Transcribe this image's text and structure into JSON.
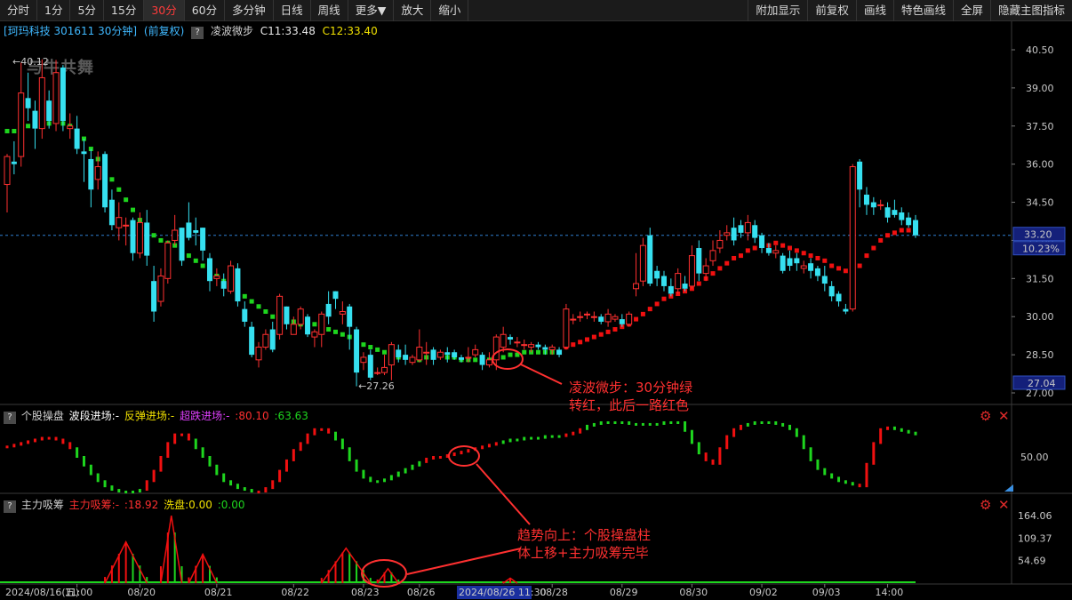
{
  "toolbar": {
    "left": [
      "分时",
      "1分",
      "5分",
      "15分",
      "30分",
      "60分",
      "多分钟",
      "日线",
      "周线",
      "更多▼",
      "放大",
      "缩小"
    ],
    "active_index": 4,
    "right": [
      "附加显示",
      "前复权",
      "画线",
      "特色画线",
      "全屏",
      "隐藏主图指标"
    ]
  },
  "info": {
    "stock": "[珂玛科技 301611 30分钟]",
    "adj": "(前复权)",
    "indicator": "凌波微步",
    "c11": "C11:33.48",
    "c12": "C12:33.40"
  },
  "watermark": "与牛共舞",
  "panel2": {
    "name": "个股操盘",
    "l1": "波段进场:-",
    "l2": "反弹进场:-",
    "l3": "超跌进场:-",
    "v1": ":80.10",
    "v2": ":63.63"
  },
  "panel3": {
    "name": "主力吸筹",
    "l1": "主力吸筹:-",
    "v1": ":18.92",
    "l2": "洗盘:0.00",
    "v2": ":0.00"
  },
  "colors": {
    "up": "#ff3030",
    "down": "#36e0f0",
    "green": "#1ed51e",
    "red": "#f01010",
    "annotation": "#ff3030",
    "price_tag_bg": "#14207a"
  },
  "price_axis": [
    "40.50",
    "39.00",
    "37.50",
    "36.00",
    "34.50",
    "33.00",
    "31.50",
    "30.00",
    "28.50",
    "27.00"
  ],
  "price_tags": {
    "current": "33.20",
    "change": "10.23%",
    "low_axis": "27.04"
  },
  "extremes": {
    "high": "40.12",
    "low": "27.26"
  },
  "panel2_axis": [
    "50.00"
  ],
  "panel3_axis": [
    "164.06",
    "109.37",
    "54.69"
  ],
  "time_axis": {
    "start": "2024/08/16(五)",
    "labels": [
      "11:00",
      "08/20",
      "08/21",
      "08/22",
      "08/23",
      "08/26",
      "08/28",
      "08/29",
      "08/30",
      "09/02",
      "09/03",
      "14:00"
    ],
    "cursor": "2024/08/26 11:30"
  },
  "annotations": [
    {
      "lines": [
        "凌波微步：30分钟绿",
        "转红，此后一路红色"
      ]
    },
    {
      "lines": [
        "趋势向上：个股操盘柱",
        "体上移+主力吸筹完毕"
      ]
    }
  ],
  "chart_data": {
    "type": "candlestick",
    "ylim": [
      27.0,
      40.5
    ],
    "candles": [
      [
        35.2,
        36.3,
        34.1,
        36.4
      ],
      [
        36.1,
        36.0,
        35.6,
        36.9
      ],
      [
        36.3,
        38.8,
        35.9,
        40.0
      ],
      [
        38.6,
        38.2,
        37.7,
        39.6
      ],
      [
        38.1,
        37.4,
        36.6,
        38.5
      ],
      [
        37.4,
        39.4,
        37.0,
        40.12
      ],
      [
        38.5,
        37.7,
        37.4,
        38.9
      ],
      [
        37.6,
        39.6,
        37.3,
        40.1
      ],
      [
        39.8,
        37.7,
        37.3,
        39.9
      ],
      [
        37.4,
        37.5,
        37.0,
        38.0
      ],
      [
        37.4,
        36.6,
        36.4,
        37.9
      ],
      [
        36.5,
        36.4,
        35.3,
        37.0
      ],
      [
        36.2,
        35.0,
        34.3,
        36.6
      ],
      [
        35.4,
        35.9,
        35.0,
        36.5
      ],
      [
        36.4,
        34.3,
        34.1,
        36.5
      ],
      [
        34.6,
        33.6,
        33.4,
        35.0
      ],
      [
        33.5,
        33.9,
        33.0,
        34.5
      ],
      [
        33.6,
        33.6,
        32.8,
        33.9
      ],
      [
        33.8,
        32.5,
        32.2,
        33.9
      ],
      [
        32.5,
        33.7,
        32.3,
        34.1
      ],
      [
        33.7,
        32.4,
        32.0,
        34.2
      ],
      [
        31.4,
        30.2,
        29.8,
        32.0
      ],
      [
        30.6,
        31.6,
        30.4,
        31.9
      ],
      [
        31.5,
        32.9,
        31.3,
        33.0
      ],
      [
        33.0,
        33.4,
        32.8,
        34.0
      ],
      [
        33.5,
        32.2,
        32.0,
        33.5
      ],
      [
        33.7,
        33.1,
        33.0,
        34.5
      ],
      [
        33.4,
        33.3,
        32.8,
        33.9
      ],
      [
        33.5,
        32.6,
        32.2,
        33.5
      ],
      [
        32.3,
        31.4,
        31.0,
        32.5
      ],
      [
        31.5,
        31.6,
        31.2,
        31.9
      ],
      [
        31.4,
        31.1,
        30.8,
        31.7
      ],
      [
        31.0,
        32.0,
        30.9,
        32.2
      ],
      [
        31.9,
        30.6,
        30.4,
        32.1
      ],
      [
        30.3,
        29.8,
        29.6,
        30.6
      ],
      [
        29.6,
        28.5,
        28.4,
        29.8
      ],
      [
        28.3,
        28.8,
        28.0,
        29.0
      ],
      [
        28.8,
        29.3,
        28.7,
        29.5
      ],
      [
        29.5,
        28.7,
        28.6,
        29.8
      ],
      [
        29.3,
        30.8,
        29.1,
        30.9
      ],
      [
        30.4,
        29.7,
        29.5,
        30.4
      ],
      [
        29.3,
        29.7,
        29.3,
        30.0
      ],
      [
        29.7,
        30.3,
        29.5,
        30.4
      ],
      [
        30.0,
        29.3,
        29.2,
        30.1
      ],
      [
        29.2,
        29.4,
        28.8,
        29.5
      ],
      [
        29.3,
        30.1,
        28.8,
        30.2
      ],
      [
        30.5,
        30.0,
        29.7,
        31.0
      ],
      [
        31.0,
        30.7,
        30.3,
        31.0
      ],
      [
        30.1,
        30.2,
        29.7,
        30.6
      ],
      [
        30.4,
        29.6,
        28.7,
        30.5
      ],
      [
        29.5,
        27.8,
        27.26,
        29.6
      ],
      [
        28.2,
        28.4,
        27.9,
        28.6
      ],
      [
        28.5,
        27.6,
        27.5,
        28.7
      ],
      [
        27.8,
        27.8,
        27.7,
        28.0
      ],
      [
        27.8,
        28.0,
        27.7,
        28.5
      ],
      [
        28.1,
        28.9,
        27.5,
        29.0
      ],
      [
        28.7,
        28.4,
        28.2,
        28.9
      ],
      [
        28.5,
        28.3,
        28.1,
        28.9
      ],
      [
        28.2,
        28.4,
        28.1,
        28.5
      ],
      [
        28.3,
        28.8,
        28.2,
        29.5
      ],
      [
        28.6,
        28.6,
        28.1,
        29.0
      ],
      [
        28.7,
        28.3,
        28.1,
        28.8
      ],
      [
        28.4,
        28.6,
        28.3,
        28.7
      ],
      [
        28.6,
        28.5,
        28.2,
        28.8
      ],
      [
        28.6,
        28.4,
        28.3,
        28.7
      ],
      [
        28.4,
        28.3,
        28.2,
        28.5
      ],
      [
        28.4,
        28.4,
        28.2,
        28.8
      ],
      [
        28.5,
        28.7,
        28.4,
        28.9
      ],
      [
        28.5,
        28.1,
        27.9,
        28.6
      ],
      [
        28.1,
        28.3,
        28.0,
        28.6
      ],
      [
        28.3,
        29.2,
        27.9,
        29.3
      ],
      [
        28.8,
        29.3,
        28.6,
        29.6
      ],
      [
        29.2,
        29.1,
        28.9,
        29.3
      ],
      [
        29.0,
        29.0,
        28.8,
        29.2
      ],
      [
        28.9,
        28.9,
        28.7,
        29.1
      ],
      [
        28.8,
        28.9,
        28.6,
        29.0
      ],
      [
        28.9,
        28.8,
        28.7,
        29.0
      ],
      [
        28.8,
        28.7,
        28.5,
        28.9
      ],
      [
        28.7,
        28.8,
        28.5,
        28.9
      ],
      [
        28.7,
        28.5,
        28.4,
        28.8
      ],
      [
        28.8,
        30.3,
        28.7,
        30.5
      ],
      [
        29.9,
        29.9,
        29.7,
        30.1
      ],
      [
        30.0,
        30.0,
        29.8,
        30.2
      ],
      [
        30.1,
        30.1,
        29.9,
        30.2
      ],
      [
        30.0,
        30.0,
        29.8,
        30.2
      ],
      [
        30.0,
        29.8,
        29.7,
        30.1
      ],
      [
        29.8,
        30.1,
        29.6,
        30.3
      ],
      [
        29.9,
        30.0,
        29.8,
        30.1
      ],
      [
        29.9,
        29.7,
        29.6,
        30.1
      ],
      [
        29.7,
        30.1,
        29.6,
        30.2
      ],
      [
        31.1,
        31.3,
        30.8,
        32.5
      ],
      [
        31.4,
        32.8,
        31.2,
        33.1
      ],
      [
        33.2,
        31.3,
        31.2,
        33.5
      ],
      [
        31.8,
        31.5,
        31.2,
        32.0
      ],
      [
        31.6,
        31.2,
        31.0,
        31.8
      ],
      [
        31.2,
        30.9,
        30.8,
        31.5
      ],
      [
        31.1,
        31.7,
        30.9,
        31.9
      ],
      [
        31.3,
        31.1,
        31.0,
        31.6
      ],
      [
        31.2,
        32.4,
        31.1,
        32.8
      ],
      [
        32.7,
        31.7,
        31.4,
        33.0
      ],
      [
        31.7,
        32.0,
        31.4,
        32.3
      ],
      [
        32.2,
        32.6,
        32.0,
        33.0
      ],
      [
        32.7,
        33.0,
        32.5,
        33.4
      ],
      [
        33.2,
        33.3,
        33.0,
        33.6
      ],
      [
        33.5,
        33.0,
        32.8,
        33.9
      ],
      [
        33.6,
        33.3,
        33.1,
        33.8
      ],
      [
        33.3,
        33.7,
        33.0,
        34.0
      ],
      [
        33.6,
        33.1,
        32.9,
        33.8
      ],
      [
        33.2,
        32.7,
        32.5,
        33.3
      ],
      [
        32.7,
        32.5,
        32.4,
        32.9
      ],
      [
        32.5,
        32.6,
        32.3,
        32.8
      ],
      [
        32.4,
        31.8,
        31.7,
        32.5
      ],
      [
        32.3,
        32.0,
        31.8,
        32.6
      ],
      [
        32.3,
        32.1,
        31.8,
        32.5
      ],
      [
        31.9,
        32.0,
        31.7,
        32.2
      ],
      [
        32.1,
        31.8,
        31.5,
        32.3
      ],
      [
        31.9,
        31.6,
        31.4,
        32.0
      ],
      [
        31.6,
        31.3,
        31.0,
        32.0
      ],
      [
        31.2,
        30.8,
        30.6,
        31.4
      ],
      [
        30.9,
        30.6,
        30.4,
        31.0
      ],
      [
        30.3,
        30.2,
        30.1,
        30.5
      ],
      [
        30.3,
        35.9,
        30.2,
        36.0
      ],
      [
        36.1,
        35.0,
        34.3,
        36.2
      ],
      [
        34.8,
        34.4,
        34.0,
        35.1
      ],
      [
        34.5,
        34.3,
        34.0,
        34.7
      ],
      [
        34.4,
        34.4,
        34.2,
        34.6
      ],
      [
        34.3,
        33.9,
        33.7,
        34.5
      ],
      [
        34.2,
        34.0,
        33.9,
        34.6
      ],
      [
        34.1,
        33.8,
        33.6,
        34.3
      ],
      [
        33.9,
        33.6,
        33.5,
        34.1
      ],
      [
        33.8,
        33.2,
        33.1,
        34.0
      ]
    ],
    "lingbo": [
      37.3,
      37.3,
      37.4,
      37.5,
      37.5,
      37.6,
      37.6,
      37.7,
      37.6,
      37.5,
      37.3,
      37.0,
      36.6,
      36.2,
      35.8,
      35.4,
      35.0,
      34.6,
      34.2,
      33.8,
      33.5,
      33.2,
      33.0,
      32.9,
      32.8,
      32.6,
      32.4,
      32.2,
      32.0,
      31.8,
      31.6,
      31.4,
      31.2,
      31.0,
      30.8,
      30.6,
      30.4,
      30.2,
      30.0,
      29.9,
      29.8,
      29.8,
      29.7,
      29.7,
      29.7,
      29.6,
      29.5,
      29.4,
      29.3,
      29.2,
      29.1,
      28.9,
      28.8,
      28.7,
      28.6,
      28.5,
      28.4,
      28.4,
      28.3,
      28.3,
      28.4,
      28.5,
      28.5,
      28.4,
      28.4,
      28.3,
      28.3,
      28.3,
      28.3,
      28.3,
      28.4,
      28.4,
      28.5,
      28.5,
      28.6,
      28.6,
      28.6,
      28.6,
      28.6,
      28.6,
      28.8,
      28.9,
      29.0,
      29.1,
      29.2,
      29.3,
      29.4,
      29.5,
      29.6,
      29.7,
      29.9,
      30.1,
      30.3,
      30.5,
      30.7,
      30.8,
      30.9,
      31.0,
      31.1,
      31.3,
      31.5,
      31.7,
      31.9,
      32.1,
      32.3,
      32.4,
      32.6,
      32.7,
      32.8,
      32.8,
      32.9,
      32.8,
      32.7,
      32.6,
      32.5,
      32.4,
      32.3,
      32.2,
      32.0,
      31.9,
      31.8,
      31.6,
      32.0,
      32.4,
      32.7,
      33.0,
      33.2,
      33.3,
      33.4,
      33.4
    ],
    "lingbo_turn_red_index": 80,
    "caopan": [
      56,
      57,
      58,
      59,
      60,
      61,
      61,
      60,
      58,
      55,
      50,
      45,
      40,
      36,
      33,
      31,
      30,
      30,
      30,
      31,
      36,
      42,
      50,
      58,
      63,
      63,
      60,
      55,
      50,
      45,
      40,
      36,
      34,
      32,
      31,
      30,
      30,
      32,
      36,
      42,
      48,
      54,
      58,
      63,
      66,
      66,
      64,
      60,
      55,
      48,
      42,
      38,
      36,
      36,
      37,
      39,
      41,
      43,
      45,
      47,
      49,
      50,
      50,
      51,
      52,
      53,
      54,
      55,
      56,
      57,
      58,
      59,
      60,
      60,
      61,
      61,
      61,
      62,
      62,
      62,
      63,
      64,
      66,
      68,
      69,
      70,
      70,
      70,
      70,
      69,
      69,
      69,
      69,
      69,
      70,
      70,
      70,
      65,
      58,
      52,
      48,
      46,
      55,
      62,
      66,
      68,
      69,
      70,
      70,
      70,
      69,
      68,
      66,
      62,
      55,
      48,
      43,
      40,
      38,
      36,
      35,
      34,
      33,
      46,
      58,
      66,
      67,
      66,
      65,
      64,
      63,
      62,
      61
    ],
    "caopan_red_ranges": [
      [
        0,
        9
      ],
      [
        20,
        26
      ],
      [
        36,
        46
      ],
      [
        60,
        70
      ],
      [
        80,
        82
      ],
      [
        100,
        105
      ],
      [
        122,
        126
      ]
    ],
    "xichou_peaks": [
      {
        "start": 14,
        "end": 20,
        "peak": 100
      },
      {
        "start": 22,
        "end": 25,
        "peak": 164.06
      },
      {
        "start": 26,
        "end": 30,
        "peak": 70
      },
      {
        "start": 45,
        "end": 52,
        "peak": 85
      },
      {
        "start": 53,
        "end": 56,
        "peak": 35
      },
      {
        "start": 71,
        "end": 73,
        "peak": 12
      }
    ],
    "panel3_ylim": [
      0,
      175
    ]
  }
}
